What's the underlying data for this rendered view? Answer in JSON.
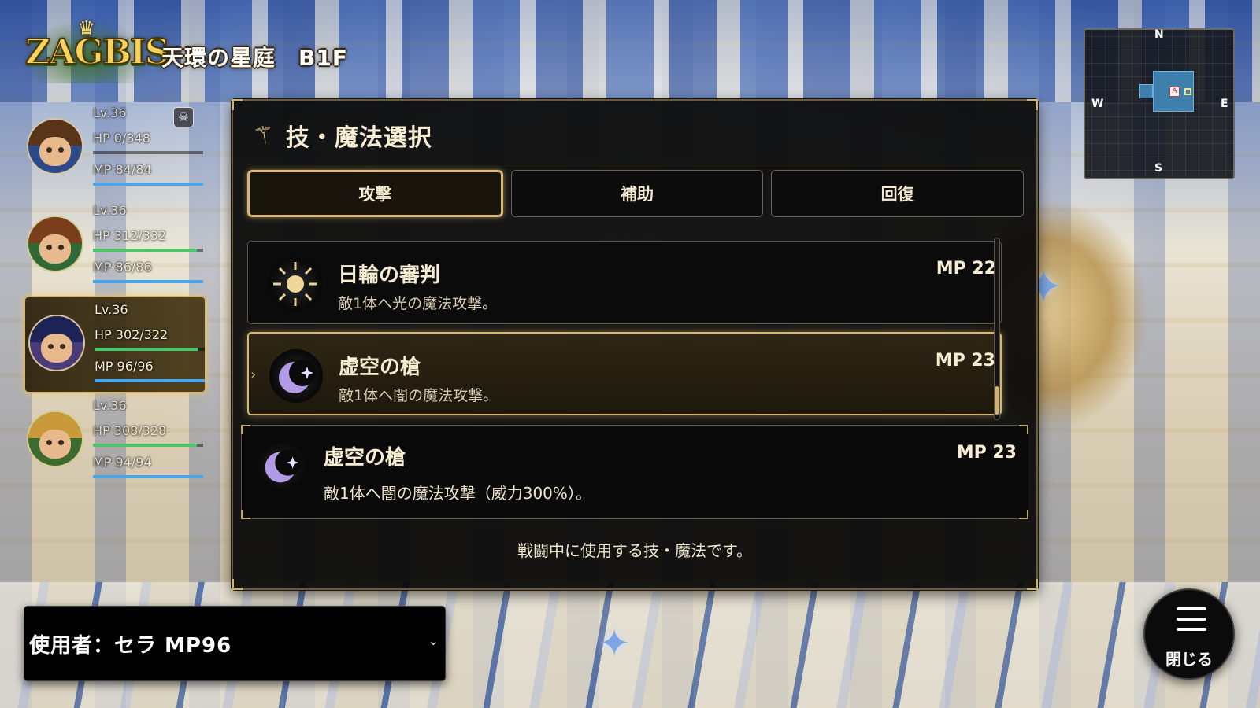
{
  "header": {
    "logo_text": "ZAGBIS",
    "location": "天環の星庭　B1F"
  },
  "party": [
    {
      "level": "Lv.36",
      "hp": "HP  0/348",
      "mp": "MP  84/84",
      "hp_ratio": 0.0,
      "mp_ratio": 1.0,
      "status": "skull-icon",
      "active": false,
      "hair": "#5a3418",
      "outfit": "#2c4a8a"
    },
    {
      "level": "Lv.36",
      "hp": "HP  312/332",
      "mp": "MP  86/86",
      "hp_ratio": 0.94,
      "mp_ratio": 1.0,
      "active": false,
      "hair": "#7a3e1c",
      "outfit": "#2f6a36"
    },
    {
      "level": "Lv.36",
      "hp": "HP  302/322",
      "mp": "MP  96/96",
      "hp_ratio": 0.94,
      "mp_ratio": 1.0,
      "active": true,
      "hair": "#1c2456",
      "outfit": "#4a3a7a"
    },
    {
      "level": "Lv.36",
      "hp": "HP  308/328",
      "mp": "MP  94/94",
      "hp_ratio": 0.94,
      "mp_ratio": 1.0,
      "active": false,
      "hair": "#c89a3a",
      "outfit": "#3d6a2e"
    }
  ],
  "minimap": {
    "north": "N",
    "south": "S",
    "west": "W",
    "east": "E",
    "player_marker": "A"
  },
  "panel": {
    "title": "技・魔法選択",
    "title_icon": "magic-wand-icon",
    "tabs": [
      {
        "label": "攻撃",
        "active": true
      },
      {
        "label": "補助",
        "active": false
      },
      {
        "label": "回復",
        "active": false
      }
    ],
    "skills": [
      {
        "name": "日輪の審判",
        "desc": "敵1体へ光の魔法攻撃。",
        "mp": "MP 22",
        "icon": "sun-icon",
        "selected": false
      },
      {
        "name": "虚空の槍",
        "desc": "敵1体へ闇の魔法攻撃。",
        "mp": "MP 23",
        "icon": "crescent-moon-icon",
        "selected": true
      }
    ],
    "selected_arrow": "›",
    "detail": {
      "name": "虚空の槍",
      "desc": "敵1体へ闇の魔法攻撃（威力300%）。",
      "mp": "MP 23",
      "icon": "crescent-moon-icon"
    },
    "footer": "戦闘中に使用する技・魔法です。"
  },
  "user_select": {
    "label": "使用者：セラ  MP96",
    "chevron": "⌄"
  },
  "close_button": {
    "label": "閉じる",
    "icon": "menu-icon"
  },
  "colors": {
    "accent_gold": "#d6b874",
    "hp_bar": "#4fc36a",
    "mp_bar": "#4aa6e8",
    "moon": "#b39ae6",
    "sun": "#f2d59a"
  }
}
